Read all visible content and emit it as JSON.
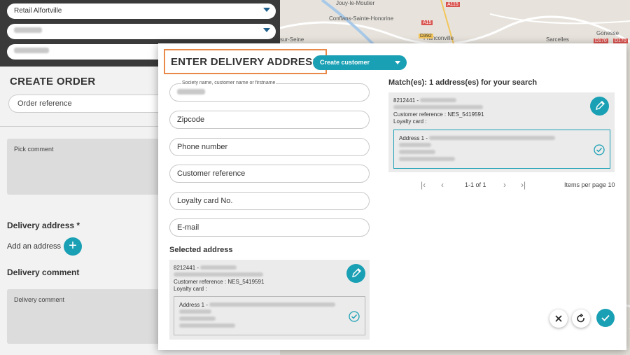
{
  "background": {
    "store_select": "Retail Alfortville",
    "page_title": "CREATE ORDER",
    "order_reference_placeholder": "Order reference",
    "pick_comment_placeholder": "Pick comment",
    "delivery_address_label": "Delivery address *",
    "add_address_label": "Add an address",
    "delivery_comment_label": "Delivery comment",
    "delivery_comment_placeholder": "Delivery comment",
    "map": {
      "labels": [
        "Jouy-le-Moutier",
        "Conflans-Sainte-Honorine",
        "Franconville",
        "Sarcelles",
        "Gonesse",
        "sur-Seine"
      ],
      "roads": [
        "A115",
        "A15",
        "D392",
        "D170",
        "D170"
      ]
    }
  },
  "modal": {
    "title": "ENTER DELIVERY ADDRESS",
    "create_customer_label": "Create customer",
    "fields": {
      "society_label": "Society name, customer name or firstname",
      "zipcode_placeholder": "Zipcode",
      "phone_placeholder": "Phone number",
      "customer_reference_placeholder": "Customer reference",
      "loyalty_placeholder": "Loyalty card No.",
      "email_placeholder": "E-mail"
    },
    "selected_address": {
      "heading": "Selected address",
      "id_prefix": "8212441 -",
      "customer_reference": "Customer reference : NES_5419591",
      "loyalty_card": "Loyalty card :",
      "address_prefix": "Address 1 -"
    },
    "matches": {
      "heading": "Match(es): 1 address(es) for your search",
      "id_prefix": "8212441 -",
      "customer_reference": "Customer reference : NES_5419591",
      "loyalty_card": "Loyalty card :",
      "address_prefix": "Address 1 -"
    },
    "pagination": {
      "range": "1-1 of 1",
      "items_per_page": "Items per page 10"
    }
  },
  "colors": {
    "accent": "#1aa0b4",
    "title_border": "#e8894a"
  }
}
